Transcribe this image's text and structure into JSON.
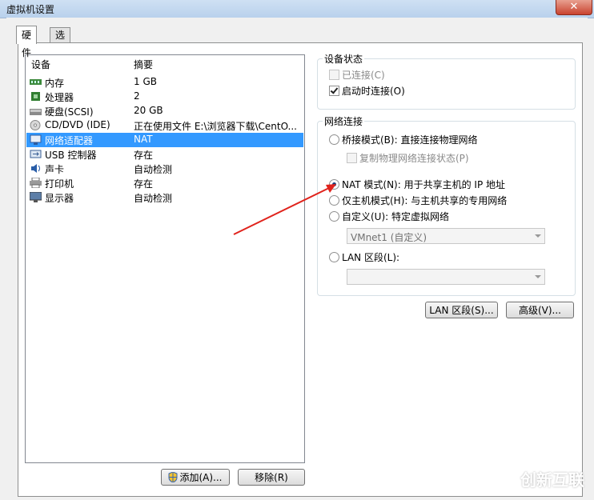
{
  "window": {
    "title": "虚拟机设置"
  },
  "tabs": [
    {
      "label": "硬件"
    },
    {
      "label": "选项"
    }
  ],
  "hardware": {
    "columns": {
      "device": "设备",
      "summary": "摘要"
    },
    "items": [
      {
        "name": "内存",
        "summary": "1 GB",
        "icon": "memory-icon"
      },
      {
        "name": "处理器",
        "summary": "2",
        "icon": "processor-icon"
      },
      {
        "name": "硬盘(SCSI)",
        "summary": "20 GB",
        "icon": "harddisk-icon"
      },
      {
        "name": "CD/DVD (IDE)",
        "summary": "正在使用文件 E:\\浏览器下载\\CentO...",
        "icon": "cd-dvd-icon"
      },
      {
        "name": "网络适配器",
        "summary": "NAT",
        "icon": "network-adapter-icon",
        "selected": true
      },
      {
        "name": "USB 控制器",
        "summary": "存在",
        "icon": "usb-icon"
      },
      {
        "name": "声卡",
        "summary": "自动检测",
        "icon": "sound-icon"
      },
      {
        "name": "打印机",
        "summary": "存在",
        "icon": "printer-icon"
      },
      {
        "name": "显示器",
        "summary": "自动检测",
        "icon": "display-icon"
      }
    ],
    "add_button": "添加(A)...",
    "remove_button": "移除(R)"
  },
  "device_status": {
    "title": "设备状态",
    "connected": {
      "label": "已连接(C)",
      "checked": false,
      "enabled": false
    },
    "connect_at_power_on": {
      "label": "启动时连接(O)",
      "checked": true
    }
  },
  "network": {
    "title": "网络连接",
    "bridged": {
      "label": "桥接模式(B): 直接连接物理网络"
    },
    "replicate": {
      "label": "复制物理网络连接状态(P)"
    },
    "nat": {
      "label": "NAT 模式(N): 用于共享主机的 IP 地址",
      "selected": true
    },
    "host_only": {
      "label": "仅主机模式(H): 与主机共享的专用网络"
    },
    "custom": {
      "label": "自定义(U): 特定虚拟网络",
      "value": "VMnet1 (自定义)"
    },
    "lan_segment": {
      "label": "LAN 区段(L):",
      "value": ""
    }
  },
  "buttons": {
    "lan_segments": "LAN 区段(S)...",
    "advanced": "高级(V)..."
  },
  "watermark": {
    "text": "创新互联"
  },
  "annotation": {
    "color": "#e0231c"
  }
}
